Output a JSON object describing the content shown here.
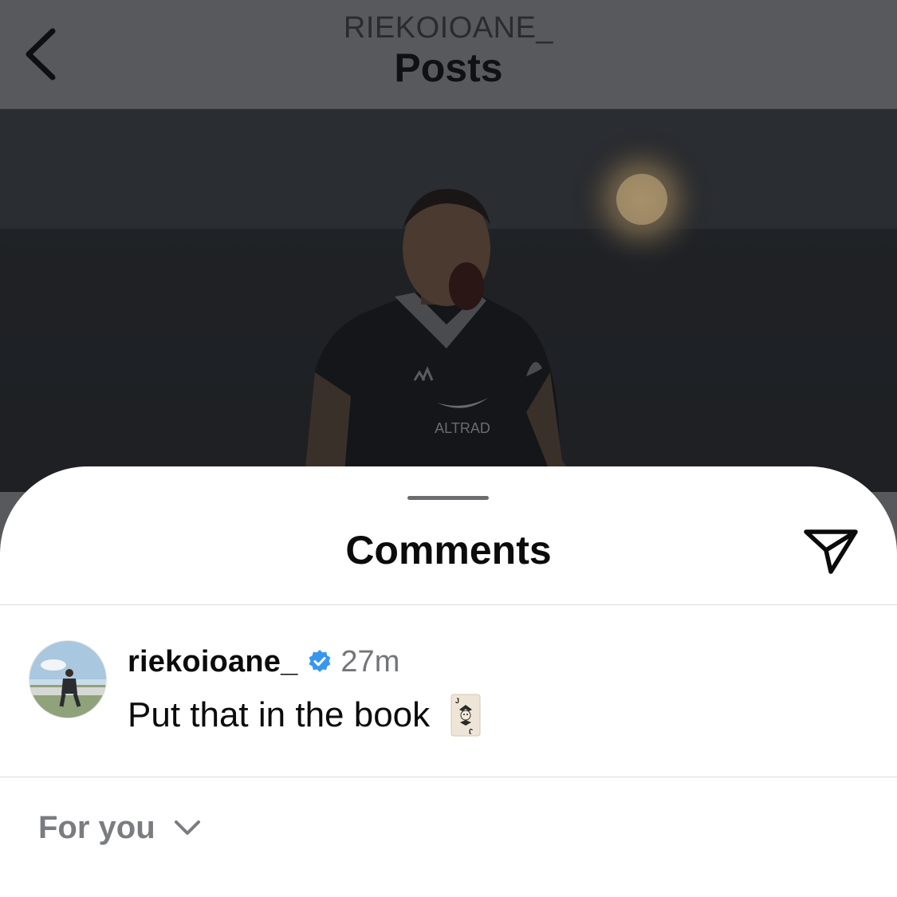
{
  "header": {
    "username": "RIEKOIOANE_",
    "title": "Posts",
    "back_icon": "chevron-left-icon"
  },
  "post": {
    "jersey_sponsor": "ALTRAD"
  },
  "comments_sheet": {
    "title": "Comments",
    "share_icon": "paper-plane-icon",
    "comments": [
      {
        "username": "riekoioane_",
        "verified": true,
        "time": "27m",
        "text": "Put that in the book",
        "emoji": "joker-card-icon"
      }
    ],
    "filter": {
      "label": "For you",
      "icon": "chevron-down-icon"
    }
  },
  "colors": {
    "overlay": "#58595c",
    "verified_blue": "#3797f0",
    "muted_text": "#737579"
  }
}
